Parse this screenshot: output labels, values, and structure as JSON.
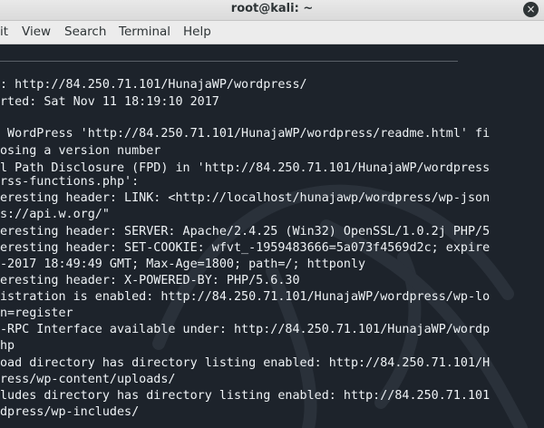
{
  "window": {
    "title": "root@kali: ~",
    "close_glyph": "×"
  },
  "menu": [
    "it",
    "View",
    "Search",
    "Terminal",
    "Help"
  ],
  "terminal_lines": [
    ": http://84.250.71.101/HunajaWP/wordpress/",
    "rted: Sat Nov 11 18:19:10 2017",
    "",
    " WordPress 'http://84.250.71.101/HunajaWP/wordpress/readme.html' fi",
    "osing a version number",
    "l Path Disclosure (FPD) in 'http://84.250.71.101/HunajaWP/wordpress",
    "rss-functions.php':",
    "eresting header: LINK: <http://localhost/hunajawp/wordpress/wp-json",
    "s://api.w.org/\"",
    "eresting header: SERVER: Apache/2.4.25 (Win32) OpenSSL/1.0.2j PHP/5",
    "eresting header: SET-COOKIE: wfvt_-1959483666=5a073f4569d2c; expire",
    "-2017 18:49:49 GMT; Max-Age=1800; path=/; httponly",
    "eresting header: X-POWERED-BY: PHP/5.6.30",
    "istration is enabled: http://84.250.71.101/HunajaWP/wordpress/wp-lo",
    "n=register",
    "-RPC Interface available under: http://84.250.71.101/HunajaWP/wordp",
    "hp",
    "oad directory has directory listing enabled: http://84.250.71.101/H",
    "ress/wp-content/uploads/",
    "ludes directory has directory listing enabled: http://84.250.71.101",
    "dpress/wp-includes/"
  ]
}
